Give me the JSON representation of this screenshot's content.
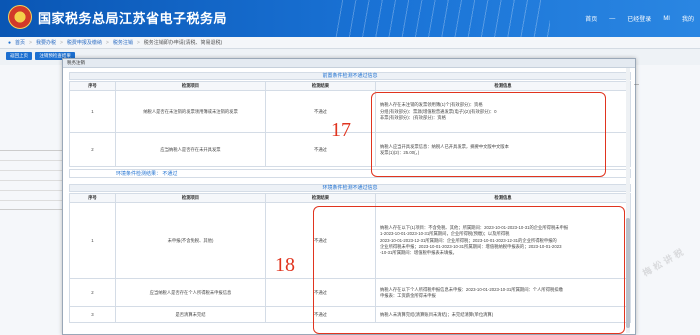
{
  "header": {
    "site_title": "国家税务总局江苏省电子税务局",
    "right_links": [
      "首页",
      "—",
      "已经登录",
      "MI",
      "我的"
    ]
  },
  "nav": {
    "items": [
      "首页",
      "我要办税",
      "税费申报及缴纳",
      "税务注销",
      "税务注销即办申请(清税、简易退税)"
    ]
  },
  "toolbar": {
    "buttons": [
      "返回上页",
      "注销预检查结果"
    ]
  },
  "modal": {
    "title": "税务注销",
    "section1_title": "前置条件检测不通过信息",
    "section2_title": "环境条件检测不通过信息",
    "failed_label": "环境条件检测结果：",
    "failed_value": "不通过",
    "headers": [
      "序号",
      "检测项目",
      "检测结果",
      "检测信息"
    ],
    "table1": [
      {
        "no": "1",
        "item": "纳税人是否在未注销的发票领用簿或未注销的发票",
        "result": "不通过",
        "detail": [
          "纳税人存在未注销的发票领用簿(1)个(有效部分)：资格",
          "分组(有效部分)：票源(增值税普通发票(电子)(2)(有效部分)：0",
          "非票(有效部分)：(有效部分)：资格"
        ]
      },
      {
        "no": "2",
        "item": "应当纳税人是否存在未开具发票",
        "result": "不通过",
        "detail": [
          "纳税人应当开具发票信息：纳税人已开具发票，摘要中文版中文版本",
          "发票(1)(2)：25.00(，)"
        ]
      }
    ],
    "table2": [
      {
        "no": "1",
        "item": "未申报(不含免税、其他)",
        "result": "不通过",
        "detail": [
          "纳税人存在以下(1)项目：不含免税、其他；所属期间：2023-10-01-2023-10-31的企业所得税未申报",
          "1-2023-10-01-2023-10-31所属期间，企业所得税(预缴)；以及所得税",
          "2023-10-01-2023-12-31所属期间：企业所得税；2023-10-01-2023-12-31的企业所得税申报的",
          "企业所得税未申报；2023-10-01-2023-10-31所属期间：增值税纳税申报表的；2023-10-01-2023",
          "-10-31所属期间：增值税申报表未填报。"
        ]
      },
      {
        "no": "2",
        "item": "应当纳税人是否存在个人所得税未申报信息",
        "result": "不通过",
        "detail": [
          "纳税人存在以下个人所得税申报信息未申报：2023-10-01-2023-10-31所属期间：个人所得税扣缴",
          "申报表：工资薪金所得未申报"
        ]
      },
      {
        "no": "3",
        "item": "是否清算未完结",
        "result": "不通过",
        "detail": [
          "纳税人未清算完结(清算账目未清结)；未完结清算(单位清算)"
        ]
      }
    ]
  },
  "annotations": {
    "label_17": "17",
    "label_18": "18"
  },
  "watermark": "梅松讲税"
}
